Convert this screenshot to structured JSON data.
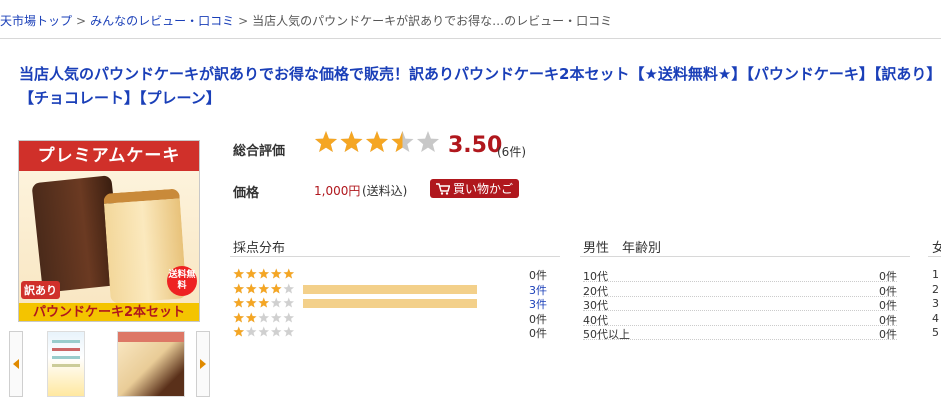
{
  "breadcrumb": {
    "items": [
      "楽天市場トップ",
      "みんなのレビュー・口コミ",
      "当店人気のパウンドケーキが訳ありでお得な…のレビュー・口コミ"
    ],
    "separator": ">"
  },
  "product": {
    "title": "当店人気のパウンドケーキが訳ありでお得な価格で販売！訳ありパウンドケーキ2本セット【★送料無料★】【パウンドケーキ】【訳あり】【チョコレート】【プレーン】",
    "image_text": {
      "banner": "プレミアムケーキ",
      "badge": "送料無料",
      "wake": "訳あり",
      "bottom": "パウンドケーキ2本セット"
    }
  },
  "rating": {
    "label": "総合評価",
    "value": "3.50",
    "value_number": 3.5,
    "max": 5,
    "count": "(6件)"
  },
  "price": {
    "label": "価格",
    "amount": "1,000円",
    "tax_note": "(送料込)",
    "cart_button": "買い物かご"
  },
  "distribution": {
    "heading": "採点分布",
    "rows": [
      {
        "stars": 5,
        "fraction": 0,
        "count": "0件",
        "linked": false
      },
      {
        "stars": 4,
        "fraction": 0.5,
        "count": "3件",
        "linked": true
      },
      {
        "stars": 3,
        "fraction": 0.5,
        "count": "3件",
        "linked": true
      },
      {
        "stars": 2,
        "fraction": 0,
        "count": "0件",
        "linked": false
      },
      {
        "stars": 1,
        "fraction": 0,
        "count": "0件",
        "linked": false
      }
    ]
  },
  "male_ages": {
    "heading": "男性　年齢別",
    "rows": [
      {
        "label": "10代",
        "count": "0件"
      },
      {
        "label": "20代",
        "count": "0件"
      },
      {
        "label": "30代",
        "count": "0件"
      },
      {
        "label": "40代",
        "count": "0件"
      },
      {
        "label": "50代以上",
        "count": "0件"
      }
    ]
  },
  "female_ages": {
    "heading_clipped": "女",
    "rows_clipped": [
      "1",
      "2",
      "3",
      "4",
      "5"
    ]
  },
  "colors": {
    "link": "#1a3fb8",
    "accent_red": "#b0171d",
    "star_fill": "#f5a623",
    "star_empty": "#c8c8c8",
    "bar": "#f3d08a"
  },
  "icons": {
    "star": "star-icon",
    "cart": "cart-icon",
    "prev": "arrow-left-icon",
    "next": "arrow-right-icon"
  }
}
